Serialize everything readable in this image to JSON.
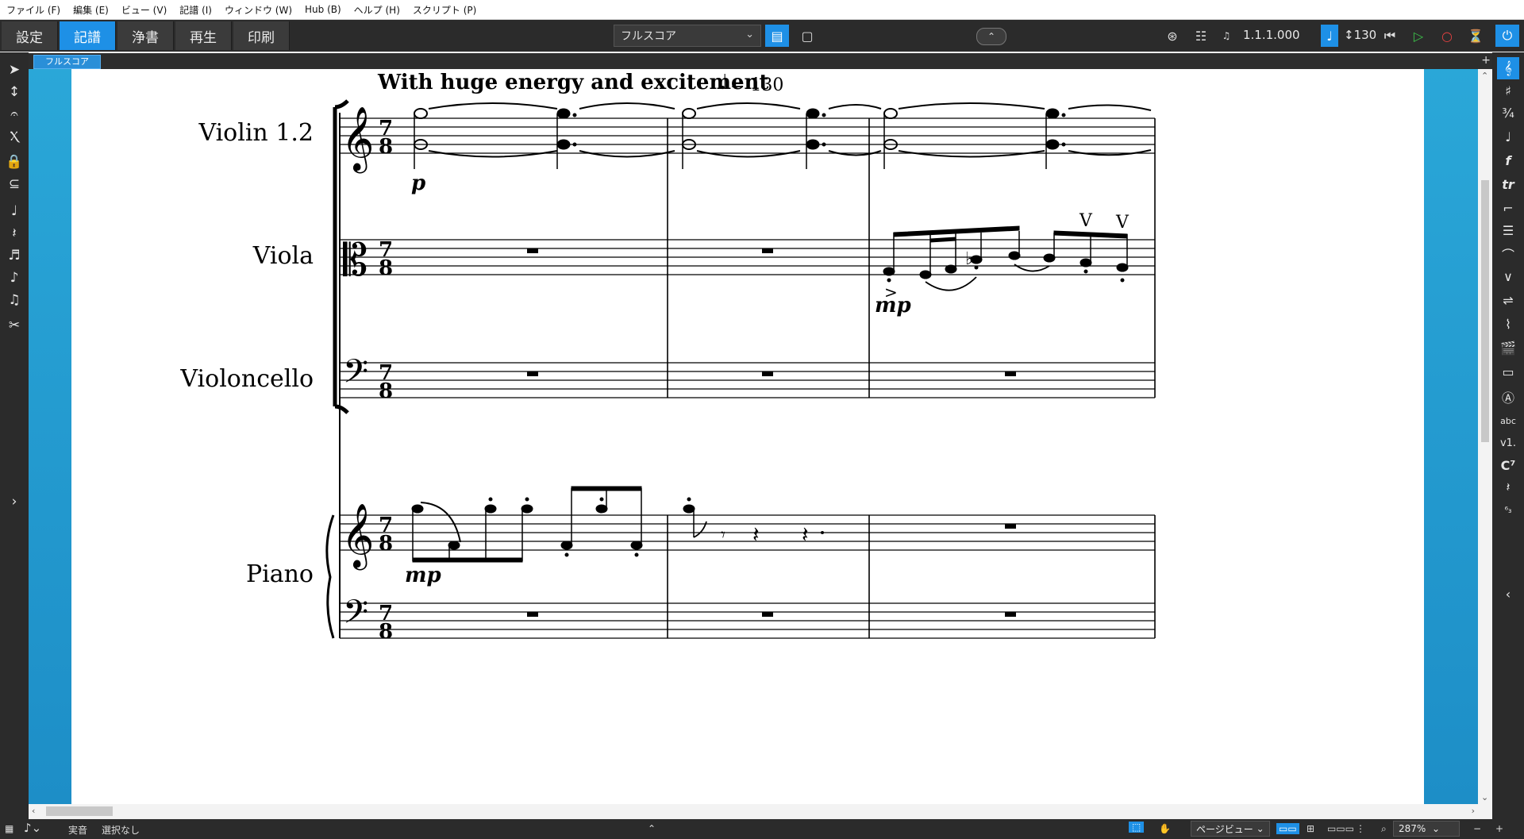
{
  "menu": [
    {
      "label": "ファイル (F)"
    },
    {
      "label": "編集 (E)"
    },
    {
      "label": "ビュー (V)"
    },
    {
      "label": "記譜 (I)"
    },
    {
      "label": "ウィンドウ (W)"
    },
    {
      "label": "Hub (B)"
    },
    {
      "label": "ヘルプ (H)"
    },
    {
      "label": "スクリプト (P)"
    }
  ],
  "modes": [
    {
      "label": "設定",
      "active": false
    },
    {
      "label": "記譜",
      "active": true
    },
    {
      "label": "浄書",
      "active": false
    },
    {
      "label": "再生",
      "active": false
    },
    {
      "label": "印刷",
      "active": false
    }
  ],
  "layout_select": {
    "value": "フルスコア"
  },
  "transport": {
    "position": "1.1.1.000",
    "tempo": "130"
  },
  "tab": {
    "label": "フルスコア"
  },
  "score": {
    "tempo_text": "With huge energy and excitement",
    "tempo_equals": "= 130",
    "time_signature": {
      "top": "7",
      "bottom": "8"
    },
    "instruments": [
      {
        "name": "Violin 1.2"
      },
      {
        "name": "Viola"
      },
      {
        "name": "Violoncello"
      },
      {
        "name": "Piano"
      }
    ],
    "dynamics": {
      "violin": "p",
      "viola": "mp",
      "piano": "mp"
    }
  },
  "status": {
    "pitch_mode": "実音",
    "selection": "選択なし",
    "view_mode": "ページビュー",
    "zoom": "287%"
  },
  "colors": {
    "accent": "#1e90e6",
    "toolbar": "#2b2b2b",
    "background_gradient": "#2aa7d8"
  }
}
